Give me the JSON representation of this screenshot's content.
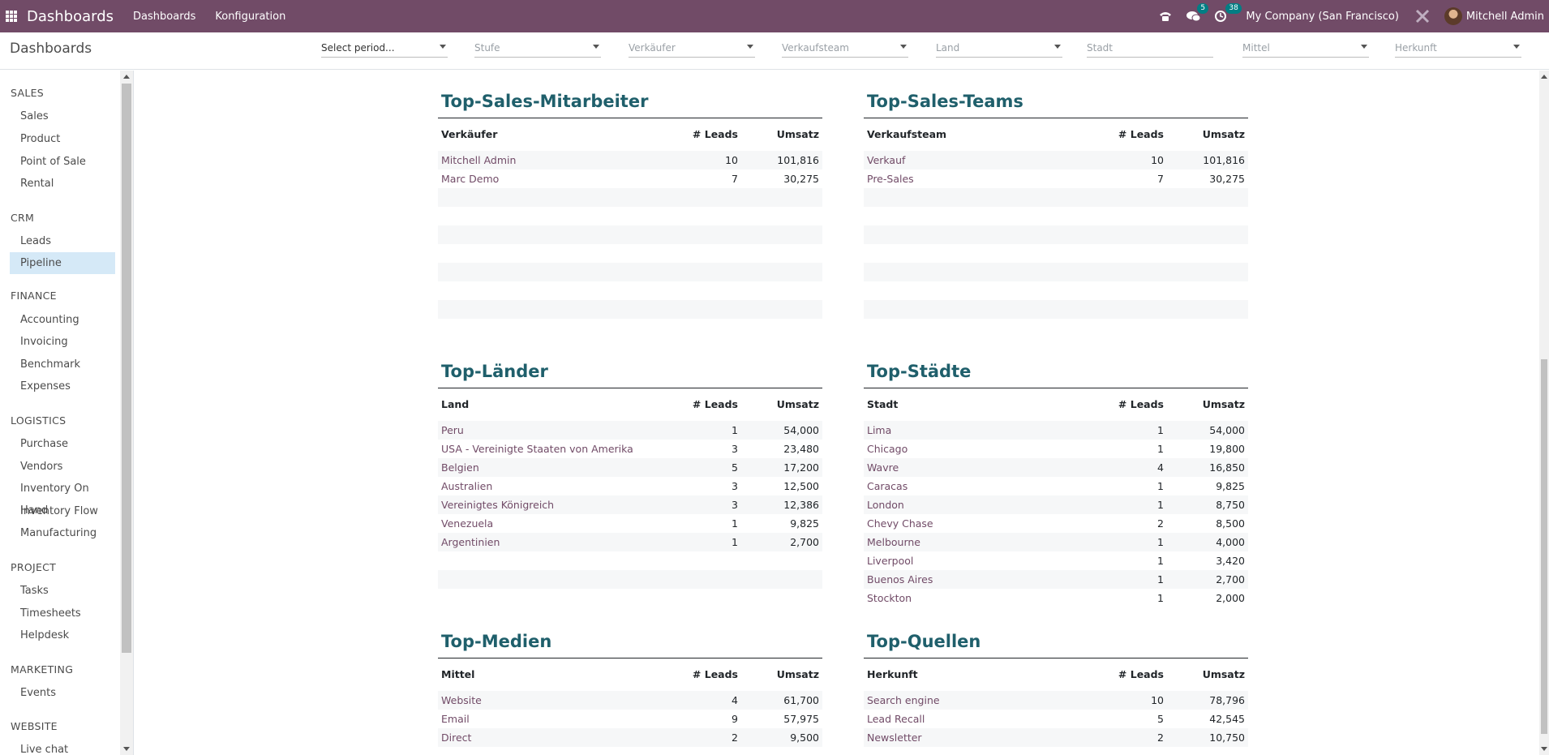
{
  "navbar": {
    "app_title": "Dashboards",
    "menus": [
      "Dashboards",
      "Konfiguration"
    ],
    "messages_count": "5",
    "activities_count": "38",
    "company": "My Company (San Francisco)",
    "user": "Mitchell Admin"
  },
  "control": {
    "title": "Dashboards",
    "filters": [
      {
        "label": "Select period...",
        "active": true
      },
      {
        "label": "Stufe"
      },
      {
        "label": "Verkäufer"
      },
      {
        "label": "Verkaufsteam"
      },
      {
        "label": "Land"
      },
      {
        "label": "Stadt"
      },
      {
        "label": "Mittel"
      },
      {
        "label": "Herkunft"
      }
    ]
  },
  "sidebar": {
    "sections": [
      {
        "title": "SALES",
        "items": [
          "Sales",
          "Product",
          "Point of Sale",
          "Rental"
        ]
      },
      {
        "title": "CRM",
        "items": [
          "Leads",
          "Pipeline"
        ]
      },
      {
        "title": "FINANCE",
        "items": [
          "Accounting",
          "Invoicing",
          "Benchmark",
          "Expenses"
        ]
      },
      {
        "title": "LOGISTICS",
        "items": [
          "Purchase",
          "Vendors",
          "Inventory On Hand",
          "Inventory Flow",
          "Manufacturing"
        ]
      },
      {
        "title": "PROJECT",
        "items": [
          "Tasks",
          "Timesheets",
          "Helpdesk"
        ]
      },
      {
        "title": "MARKETING",
        "items": [
          "Events"
        ]
      },
      {
        "title": "WEBSITE",
        "items": [
          "Live chat"
        ]
      }
    ],
    "active_item": "Pipeline"
  },
  "panels": {
    "salespeople": {
      "title": "Top-Sales-Mitarbeiter",
      "headers": [
        "Verkäufer",
        "# Leads",
        "Umsatz"
      ],
      "rows": [
        [
          "Mitchell Admin",
          "10",
          "101,816"
        ],
        [
          "Marc Demo",
          "7",
          "30,275"
        ]
      ]
    },
    "teams": {
      "title": "Top-Sales-Teams",
      "headers": [
        "Verkaufsteam",
        "# Leads",
        "Umsatz"
      ],
      "rows": [
        [
          "Verkauf",
          "10",
          "101,816"
        ],
        [
          "Pre-Sales",
          "7",
          "30,275"
        ]
      ]
    },
    "countries": {
      "title": "Top-Länder",
      "headers": [
        "Land",
        "# Leads",
        "Umsatz"
      ],
      "rows": [
        [
          "Peru",
          "1",
          "54,000"
        ],
        [
          "USA - Vereinigte Staaten von Amerika",
          "3",
          "23,480"
        ],
        [
          "Belgien",
          "5",
          "17,200"
        ],
        [
          "Australien",
          "3",
          "12,500"
        ],
        [
          "Vereinigtes Königreich",
          "3",
          "12,386"
        ],
        [
          "Venezuela",
          "1",
          "9,825"
        ],
        [
          "Argentinien",
          "1",
          "2,700"
        ]
      ]
    },
    "cities": {
      "title": "Top-Städte",
      "headers": [
        "Stadt",
        "# Leads",
        "Umsatz"
      ],
      "rows": [
        [
          "Lima",
          "1",
          "54,000"
        ],
        [
          "Chicago",
          "1",
          "19,800"
        ],
        [
          "Wavre",
          "4",
          "16,850"
        ],
        [
          "Caracas",
          "1",
          "9,825"
        ],
        [
          "London",
          "1",
          "8,750"
        ],
        [
          "Chevy Chase",
          "2",
          "8,500"
        ],
        [
          "Melbourne",
          "1",
          "4,000"
        ],
        [
          "Liverpool",
          "1",
          "3,420"
        ],
        [
          "Buenos Aires",
          "1",
          "2,700"
        ],
        [
          "Stockton",
          "1",
          "2,000"
        ]
      ]
    },
    "media": {
      "title": "Top-Medien",
      "headers": [
        "Mittel",
        "# Leads",
        "Umsatz"
      ],
      "rows": [
        [
          "Website",
          "4",
          "61,700"
        ],
        [
          "Email",
          "9",
          "57,975"
        ],
        [
          "Direct",
          "2",
          "9,500"
        ]
      ]
    },
    "sources": {
      "title": "Top-Quellen",
      "headers": [
        "Herkunft",
        "# Leads",
        "Umsatz"
      ],
      "rows": [
        [
          "Search engine",
          "10",
          "78,796"
        ],
        [
          "Lead Recall",
          "5",
          "42,545"
        ],
        [
          "Newsletter",
          "2",
          "10,750"
        ]
      ]
    }
  }
}
